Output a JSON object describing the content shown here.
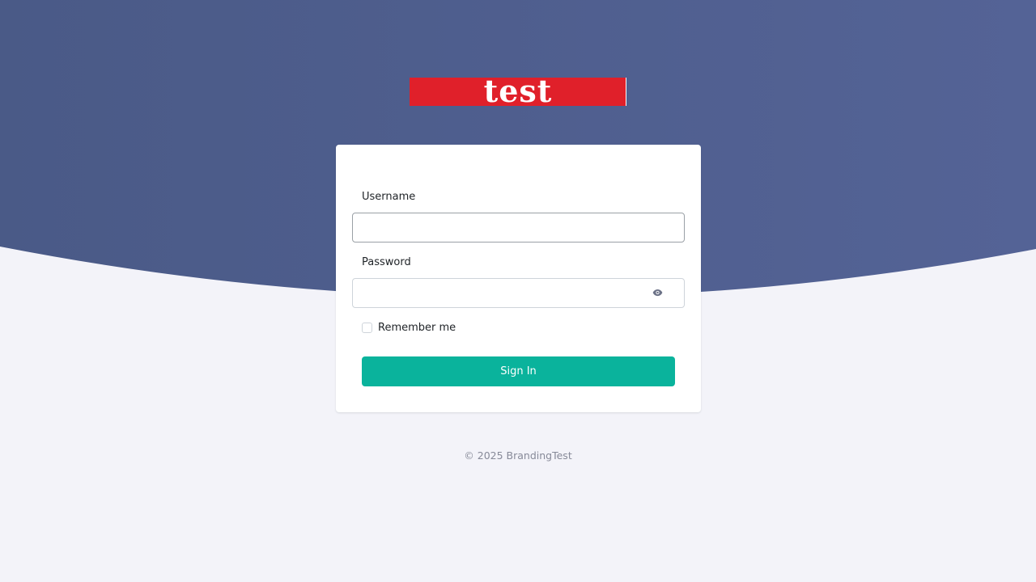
{
  "logo": {
    "text": "test",
    "background_color": "#e0202a"
  },
  "login_form": {
    "username_label": "Username",
    "username_value": "",
    "password_label": "Password",
    "password_value": "",
    "toggle_password_icon": "eye-icon",
    "remember_label": "Remember me",
    "remember_checked": false,
    "submit_label": "Sign In"
  },
  "footer": {
    "copyright": "© 2025 BrandingTest"
  },
  "colors": {
    "hero_background": "#4b5a8a",
    "page_background": "#f3f3f9",
    "primary_button": "#0ab39c"
  }
}
